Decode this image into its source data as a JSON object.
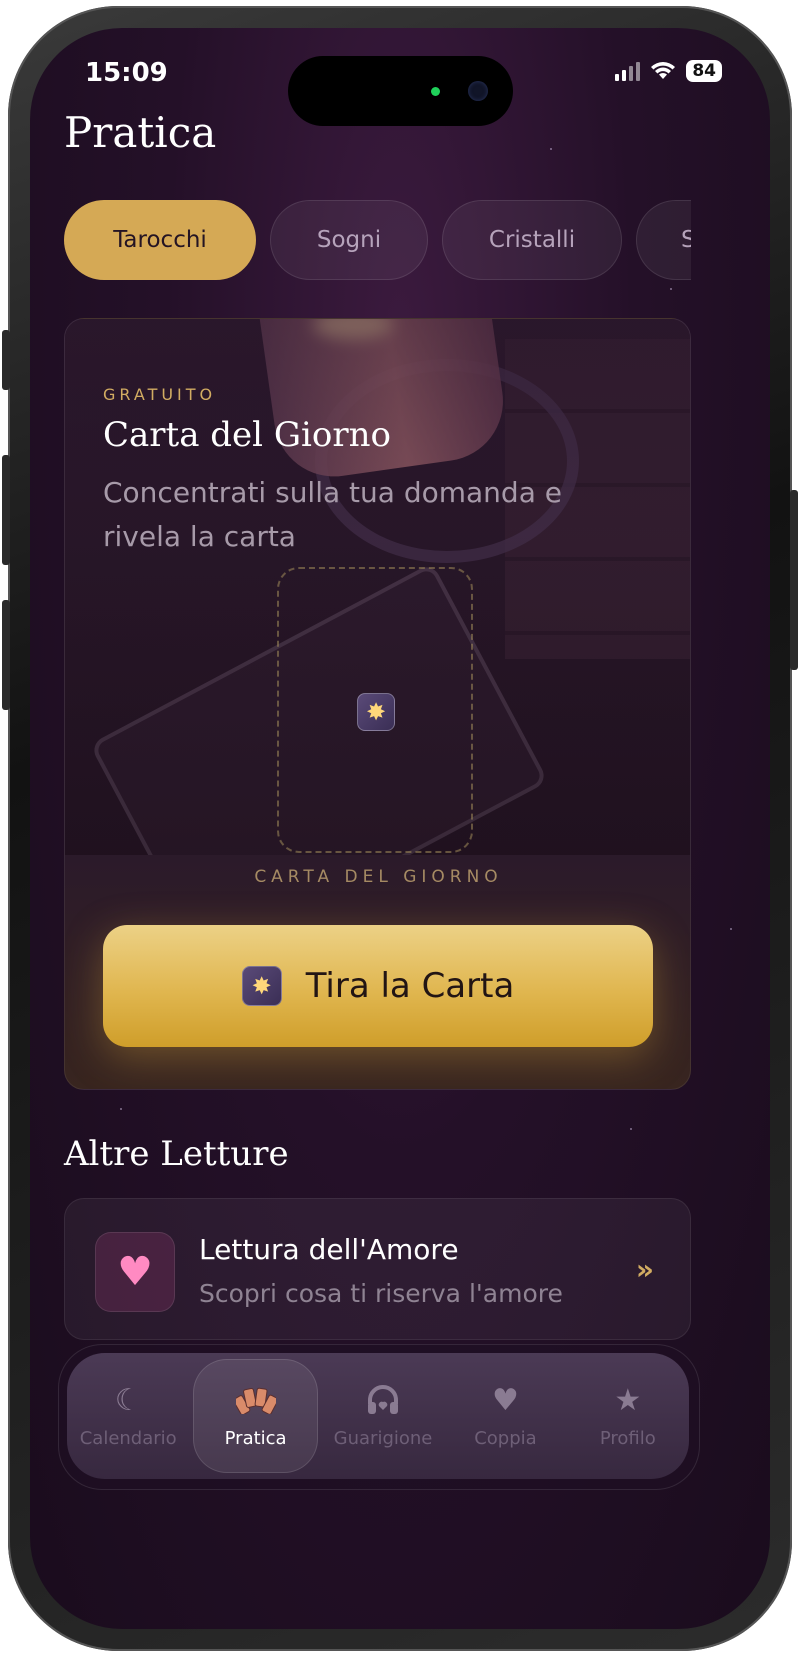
{
  "status_bar": {
    "time": "15:09",
    "battery": "84"
  },
  "page": {
    "title": "Pratica"
  },
  "tabs": [
    {
      "label": "Tarocchi",
      "active": true
    },
    {
      "label": "Sogni",
      "active": false
    },
    {
      "label": "Cristalli",
      "active": false
    },
    {
      "label": "S",
      "active": false
    }
  ],
  "daily_card": {
    "badge": "GRATUITO",
    "title": "Carta del Giorno",
    "subtitle": "Concentrati sulla tua domanda e rivela la carta",
    "caption": "CARTA DEL GIORNO",
    "button_label": "Tira la Carta"
  },
  "other_readings": {
    "title": "Altre Letture",
    "items": [
      {
        "title": "Lettura dell'Amore",
        "subtitle": "Scopri cosa ti riserva l'amore",
        "icon": "heart-icon"
      }
    ]
  },
  "nav": [
    {
      "label": "Calendario",
      "icon": "moon-icon",
      "active": false
    },
    {
      "label": "Pratica",
      "icon": "tarot-fan-icon",
      "active": true
    },
    {
      "label": "Guarigione",
      "icon": "headphones-icon",
      "active": false
    },
    {
      "label": "Coppia",
      "icon": "heart-icon",
      "active": false
    },
    {
      "label": "Profilo",
      "icon": "star-icon",
      "active": false
    }
  ],
  "colors": {
    "accent": "#d5a955",
    "background": "#241028"
  }
}
